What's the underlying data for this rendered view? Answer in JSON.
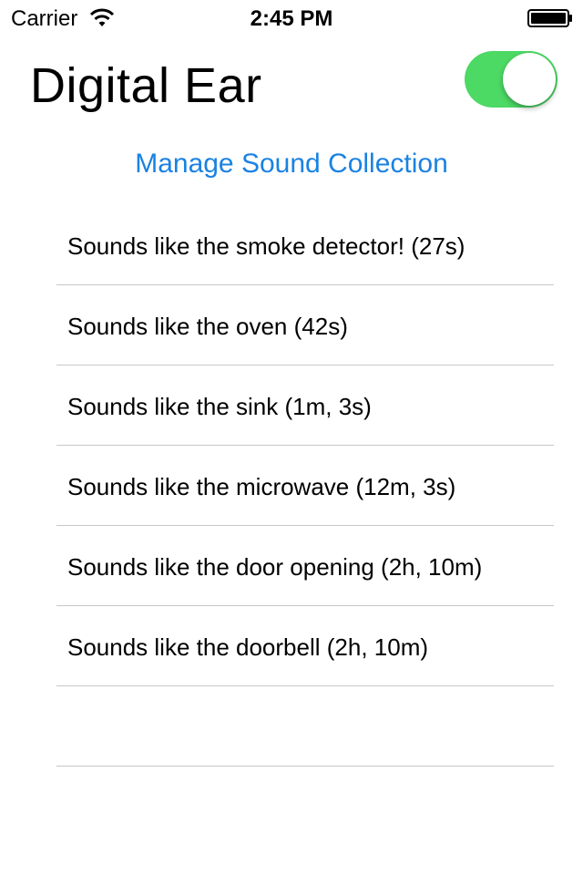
{
  "status_bar": {
    "carrier": "Carrier",
    "time": "2:45 PM",
    "wifi_icon": "wifi-icon",
    "battery_icon": "battery-icon"
  },
  "header": {
    "title": "Digital Ear",
    "toggle_on": true,
    "toggle_color": "#4cd964"
  },
  "manage_link": {
    "label": "Manage Sound Collection",
    "color": "#1a82e2"
  },
  "sounds": [
    {
      "label": "Sounds like the smoke detector! (27s)"
    },
    {
      "label": "Sounds like the oven (42s)"
    },
    {
      "label": "Sounds like the sink (1m, 3s)"
    },
    {
      "label": "Sounds like the microwave (12m, 3s)"
    },
    {
      "label": "Sounds like the door opening (2h, 10m)"
    },
    {
      "label": "Sounds like the doorbell (2h, 10m)"
    },
    {
      "label": ""
    }
  ]
}
